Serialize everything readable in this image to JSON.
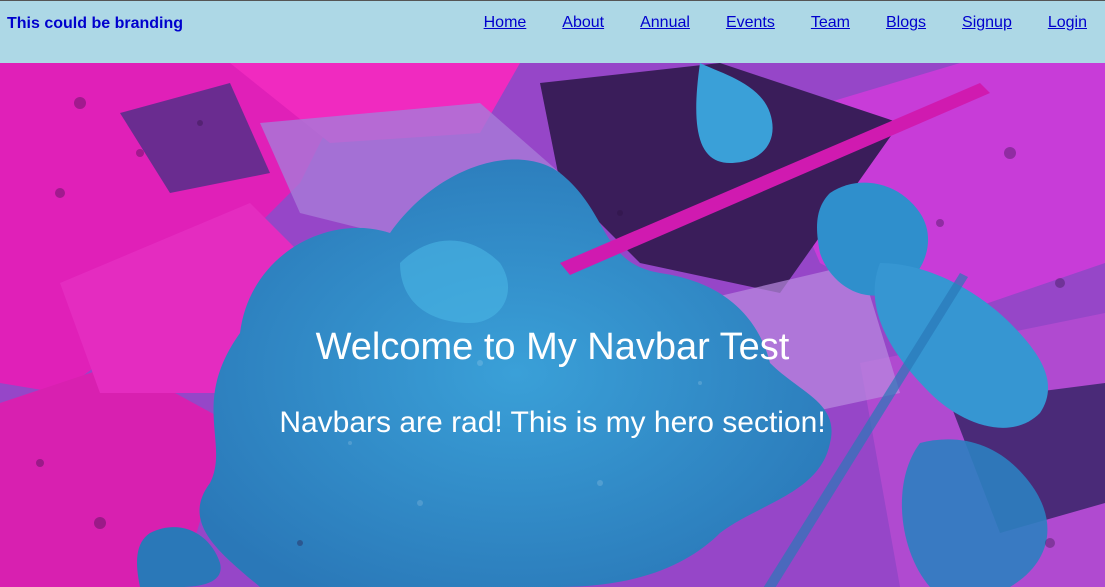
{
  "navbar": {
    "brand": "This could be branding",
    "links": [
      {
        "label": "Home"
      },
      {
        "label": "About"
      },
      {
        "label": "Annual"
      },
      {
        "label": "Events"
      },
      {
        "label": "Team"
      },
      {
        "label": "Blogs"
      },
      {
        "label": "Signup"
      },
      {
        "label": "Login"
      }
    ],
    "background_color": "#add8e6",
    "link_color": "#0000cd"
  },
  "hero": {
    "title": "Welcome to My Navbar Test",
    "subtitle": "Navbars are rad! This is my hero section!",
    "text_color": "#ffffff",
    "background_image": "abstract-paint-background"
  }
}
